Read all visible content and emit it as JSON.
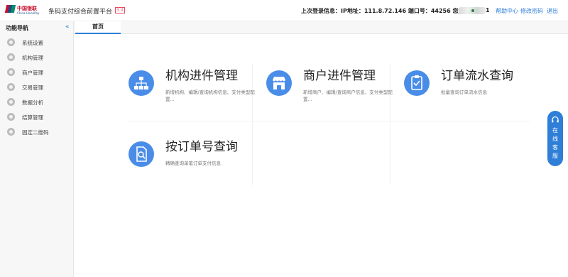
{
  "header": {
    "logo_cn": "中国银联",
    "logo_en": "China UnionPay",
    "app_title": "条码支付综合前置平台",
    "app_badge": "3.0",
    "login_info": "上次登录信息：IP地址：111.8.72.146  端口号：44256  您好：4",
    "user_tail": "1",
    "links": {
      "help": "帮助中心",
      "change_password": "修改密码",
      "logout": "退出"
    }
  },
  "sidebar": {
    "title": "功能导航",
    "collapse_glyph": "«",
    "items": [
      {
        "label": "系统设置"
      },
      {
        "label": "机构管理"
      },
      {
        "label": "商户管理"
      },
      {
        "label": "交易管理"
      },
      {
        "label": "数据分析"
      },
      {
        "label": "结算管理"
      },
      {
        "label": "固定二维码"
      }
    ]
  },
  "tabs": [
    {
      "label": "首页"
    }
  ],
  "tiles": [
    {
      "title": "机构进件管理",
      "desc": "新增机构、编辑/查询机构信息、支付类型配置...",
      "icon": "org-tree-icon"
    },
    {
      "title": "商户进件管理",
      "desc": "新增商户、编辑/查询商户信息、支付类型配置...",
      "icon": "store-icon"
    },
    {
      "title": "订单流水查询",
      "desc": "批量查询订单流水信息",
      "icon": "clipboard-check-icon"
    },
    {
      "title": "按订单号查询",
      "desc": "精确查询单笔订单支付信息",
      "icon": "document-search-icon"
    }
  ],
  "customer_service": {
    "label": "在线客服",
    "chars": [
      "在",
      "线",
      "客",
      "服"
    ],
    "icon": "headset-icon"
  },
  "colors": {
    "primary": "#2f7ed8",
    "icon_bg": "#4a8de8",
    "brand_red": "#c8102e"
  }
}
